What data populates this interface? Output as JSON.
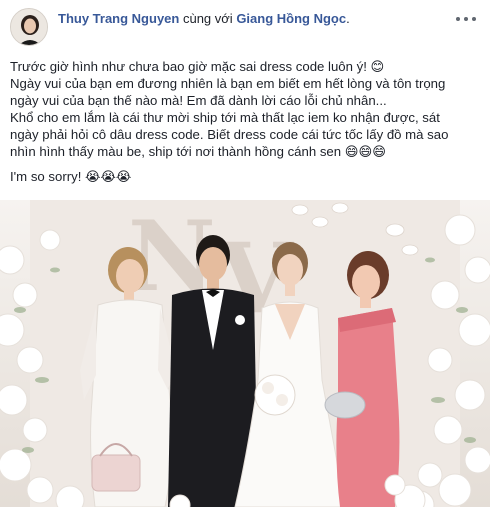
{
  "post": {
    "author": "Thuy Trang Nguyen",
    "with_text": "cùng với",
    "tagged": "Giang Hồng Ngọc",
    "lines": [
      "Trước giờ hình như chưa bao giờ mặc sai dress code luôn ý! 😊",
      "Ngày vui của bạn em đương nhiên là bạn em biết em hết lòng và tôn trọng",
      "ngày vui của bạn thế nào mà! Em đã dành lời cáo lỗi chủ nhân...",
      "Khổ cho em lắm là cái thư mời ship tới mà thất lạc iem ko nhận được, sát",
      "ngày phải hỏi cô dâu dress code. Biết dress code cái tức tốc lấy đồ mà sao",
      "nhìn hình thấy màu be, ship tới nơi thành hồng cánh sen 😄😄😄"
    ],
    "sorry": "I'm so sorry! 😭😭😭"
  },
  "icons": {
    "more": "more-horizontal-icon"
  },
  "colors": {
    "link": "#385898",
    "text": "#1d2129",
    "pink_dress": "#e8808a"
  }
}
